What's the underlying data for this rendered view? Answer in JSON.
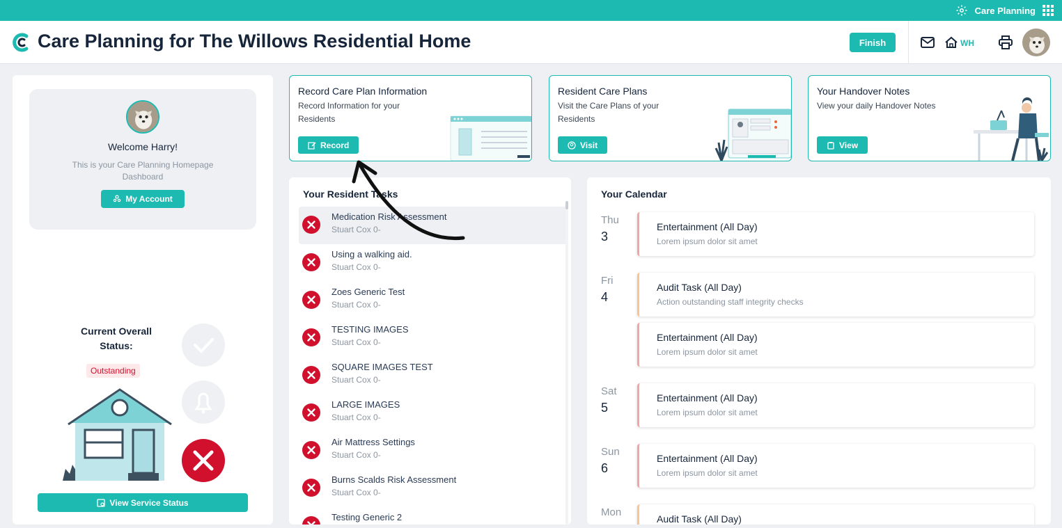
{
  "topbar": {
    "app_label": "Care Planning",
    "accent": "#1cbab1"
  },
  "header": {
    "title": "Care Planning for The Willows Residential Home",
    "finish_label": "Finish",
    "home_label": "WH"
  },
  "sidebar": {
    "welcome": "Welcome Harry!",
    "subtitle": "This is your Care Planning Homepage Dashboard",
    "account_label": "My Account",
    "status_label": "Current Overall Status:",
    "status_value": "Outstanding",
    "view_status_label": "View Service Status"
  },
  "cards": [
    {
      "title": "Record Care Plan Information",
      "desc": "Record Information for your Residents",
      "button": "Record"
    },
    {
      "title": "Resident Care Plans",
      "desc": "Visit the Care Plans of your Residents",
      "button": "Visit"
    },
    {
      "title": "Your Handover Notes",
      "desc": "View your daily Handover Notes",
      "button": "View"
    }
  ],
  "tasks": {
    "title": "Your Resident Tasks",
    "items": [
      {
        "name": "Medication Risk Assessment",
        "sub": "Stuart Cox 0-"
      },
      {
        "name": "Using a walking aid.",
        "sub": "Stuart Cox 0-"
      },
      {
        "name": "Zoes Generic Test",
        "sub": "Stuart Cox 0-"
      },
      {
        "name": "TESTING IMAGES",
        "sub": "Stuart Cox 0-"
      },
      {
        "name": "SQUARE IMAGES TEST",
        "sub": "Stuart Cox 0-"
      },
      {
        "name": "LARGE IMAGES",
        "sub": "Stuart Cox 0-"
      },
      {
        "name": "Air Mattress Settings",
        "sub": "Stuart Cox 0-"
      },
      {
        "name": "Burns Scalds Risk Assessment",
        "sub": "Stuart Cox 0-"
      },
      {
        "name": "Testing Generic 2",
        "sub": ""
      }
    ]
  },
  "calendar": {
    "title": "Your Calendar",
    "days": [
      {
        "name": "Thu",
        "num": "3"
      },
      {
        "name": "Fri",
        "num": "4"
      },
      {
        "name": "Sat",
        "num": "5"
      },
      {
        "name": "Sun",
        "num": "6"
      },
      {
        "name": "Mon",
        "num": ""
      }
    ],
    "events": [
      {
        "title": "Entertainment (All Day)",
        "desc": "Lorem ipsum dolor sit amet"
      },
      {
        "title": "Audit Task (All Day)",
        "desc": "Action outstanding staff integrity checks"
      },
      {
        "title": "Entertainment (All Day)",
        "desc": "Lorem ipsum dolor sit amet"
      },
      {
        "title": "Entertainment (All Day)",
        "desc": "Lorem ipsum dolor sit amet"
      },
      {
        "title": "Entertainment (All Day)",
        "desc": "Lorem ipsum dolor sit amet"
      },
      {
        "title": "Audit Task (All Day)",
        "desc": ""
      }
    ]
  },
  "colors": {
    "teal": "#1cbab1",
    "danger": "#d0102c",
    "event_pink": "#f2a5a8",
    "event_orange": "#f8c48f"
  }
}
